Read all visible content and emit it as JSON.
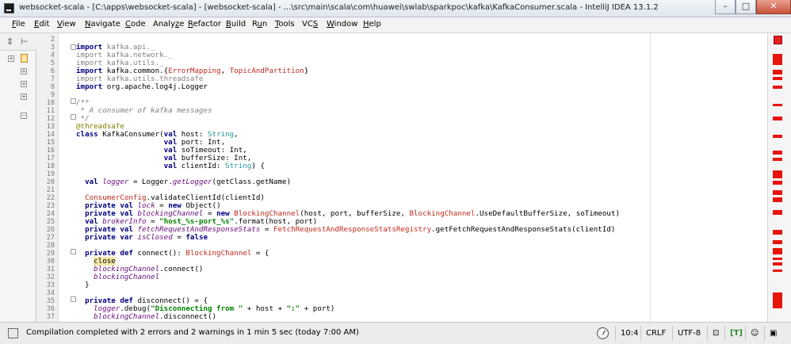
{
  "window": {
    "title": "websocket-scala - [C:\\apps\\websocket-scala] - [websocket-scala] - ...\\src\\main\\scala\\com\\huawei\\swlab\\sparkpoc\\kafka\\KafkaConsumer.scala - IntelliJ IDEA 13.1.2",
    "buttons": {
      "minimize": "–",
      "maximize": "□",
      "close": "✕"
    }
  },
  "menu": [
    {
      "pre": "",
      "ul": "F",
      "post": "ile"
    },
    {
      "pre": "",
      "ul": "E",
      "post": "dit"
    },
    {
      "pre": "",
      "ul": "V",
      "post": "iew"
    },
    {
      "pre": "",
      "ul": "N",
      "post": "avigate"
    },
    {
      "pre": "",
      "ul": "C",
      "post": "ode"
    },
    {
      "pre": "Analy",
      "ul": "z",
      "post": "e"
    },
    {
      "pre": "",
      "ul": "R",
      "post": "efactor"
    },
    {
      "pre": "",
      "ul": "B",
      "post": "uild"
    },
    {
      "pre": "R",
      "ul": "u",
      "post": "n"
    },
    {
      "pre": "",
      "ul": "T",
      "post": "ools"
    },
    {
      "pre": "VC",
      "ul": "S",
      "post": ""
    },
    {
      "pre": "",
      "ul": "W",
      "post": "indow"
    },
    {
      "pre": "",
      "ul": "H",
      "post": "elp"
    }
  ],
  "toolbar": {
    "collapse_icon": "collapse-all-icon",
    "settings_icon": "settings-icon"
  },
  "editor": {
    "line_numbers": [
      "2",
      "3",
      "4",
      "5",
      "6",
      "7",
      "8",
      "9",
      "10",
      "11",
      "12",
      "13",
      "14",
      "15",
      "16",
      "17",
      "18",
      "19",
      "20",
      "21",
      "22",
      "23",
      "24",
      "25",
      "26",
      "27",
      "28",
      "29",
      "30",
      "31",
      "32",
      "33",
      "34",
      "35",
      "36",
      "37"
    ],
    "lines": [
      [],
      [
        [
          "k",
          "import "
        ],
        [
          "p",
          "kafka.api._"
        ]
      ],
      [
        [
          "p",
          "import kafka.network._"
        ]
      ],
      [
        [
          "p",
          "import kafka.utils._"
        ]
      ],
      [
        [
          "k",
          "import "
        ],
        [
          "",
          "kafka.common.{"
        ],
        [
          "r",
          "ErrorMapping"
        ],
        [
          "",
          ", "
        ],
        [
          "r",
          "TopicAndPartition"
        ],
        [
          "",
          "}"
        ]
      ],
      [
        [
          "p",
          "import kafka.utils.threadsafe"
        ]
      ],
      [
        [
          "k",
          "import "
        ],
        [
          "",
          "org.apache.log4j.Logger"
        ]
      ],
      [],
      [
        [
          "c",
          "/**"
        ]
      ],
      [
        [
          "c",
          " * A consumer of kafka messages"
        ]
      ],
      [
        [
          "c",
          " */"
        ]
      ],
      [
        [
          "a",
          "@threadsafe"
        ]
      ],
      [
        [
          "k",
          "class "
        ],
        [
          "",
          "KafkaConsumer("
        ],
        [
          "k",
          "val "
        ],
        [
          "",
          "host: "
        ],
        [
          "t",
          "String"
        ],
        [
          "",
          ","
        ]
      ],
      [
        [
          "",
          "                    "
        ],
        [
          "k",
          "val "
        ],
        [
          "",
          "port: Int,"
        ]
      ],
      [
        [
          "",
          "                    "
        ],
        [
          "k",
          "val "
        ],
        [
          "",
          "soTimeout: Int,"
        ]
      ],
      [
        [
          "",
          "                    "
        ],
        [
          "k",
          "val "
        ],
        [
          "",
          "bufferSize: Int,"
        ]
      ],
      [
        [
          "",
          "                    "
        ],
        [
          "k",
          "val "
        ],
        [
          "",
          "clientId: "
        ],
        [
          "t",
          "String"
        ],
        [
          "",
          ") {"
        ]
      ],
      [],
      [
        [
          "",
          "  "
        ],
        [
          "k",
          "val "
        ],
        [
          "i",
          "logger"
        ],
        [
          "",
          " = Logger."
        ],
        [
          "i",
          "getLogger"
        ],
        [
          "",
          "(getClass.getName)"
        ]
      ],
      [],
      [
        [
          "",
          "  "
        ],
        [
          "r",
          "ConsumerConfig"
        ],
        [
          "",
          ".validateClientId(clientId)"
        ]
      ],
      [
        [
          "",
          "  "
        ],
        [
          "k",
          "private val "
        ],
        [
          "i",
          "lock"
        ],
        [
          "",
          " = "
        ],
        [
          "k",
          "new "
        ],
        [
          "",
          "Object()"
        ]
      ],
      [
        [
          "",
          "  "
        ],
        [
          "k",
          "private val "
        ],
        [
          "i",
          "blockingChannel"
        ],
        [
          "",
          " = "
        ],
        [
          "k",
          "new "
        ],
        [
          "r",
          "BlockingChannel"
        ],
        [
          "",
          "(host, port, bufferSize, "
        ],
        [
          "r",
          "BlockingChannel"
        ],
        [
          "",
          ".UseDefaultBufferSize, soTimeout)"
        ]
      ],
      [
        [
          "",
          "  "
        ],
        [
          "k",
          "val "
        ],
        [
          "i",
          "brokerInfo"
        ],
        [
          "",
          " = "
        ],
        [
          "s",
          "\"host_%s-port_%s\""
        ],
        [
          "",
          ".format(host, port)"
        ]
      ],
      [
        [
          "",
          "  "
        ],
        [
          "k",
          "private val "
        ],
        [
          "i",
          "fetchRequestAndResponseStats"
        ],
        [
          "",
          " = "
        ],
        [
          "r",
          "FetchRequestAndResponseStatsRegistry"
        ],
        [
          "",
          ".getFetchRequestAndResponseStats(clientId)"
        ]
      ],
      [
        [
          "",
          "  "
        ],
        [
          "k",
          "private var "
        ],
        [
          "i",
          "isClosed"
        ],
        [
          "",
          " = "
        ],
        [
          "k",
          "false"
        ]
      ],
      [],
      [
        [
          "",
          "  "
        ],
        [
          "k",
          "private def "
        ],
        [
          "",
          "connect(): "
        ],
        [
          "r",
          "BlockingChannel"
        ],
        [
          "",
          " = {"
        ]
      ],
      [
        [
          "",
          "    "
        ],
        [
          "hl",
          "close"
        ]
      ],
      [
        [
          "",
          "    "
        ],
        [
          "i",
          "blockingChannel"
        ],
        [
          "",
          ".connect()"
        ]
      ],
      [
        [
          "",
          "    "
        ],
        [
          "i",
          "blockingChannel"
        ]
      ],
      [
        [
          "",
          "  }"
        ]
      ],
      [],
      [
        [
          "",
          "  "
        ],
        [
          "k",
          "private def "
        ],
        [
          "",
          "disconnect() = {"
        ]
      ],
      [
        [
          "",
          "    "
        ],
        [
          "i",
          "logger"
        ],
        [
          "",
          ".debug("
        ],
        [
          "s",
          "\"Disconnecting from \""
        ],
        [
          "",
          " + host + "
        ],
        [
          "s",
          "\":\""
        ],
        [
          "",
          " + port)"
        ]
      ],
      [
        [
          "",
          "    "
        ],
        [
          "i",
          "blockingChannel"
        ],
        [
          "",
          ".disconnect()"
        ]
      ]
    ]
  },
  "status": {
    "message": "Compilation completed with 2 errors and 2 warnings in 1 min 5 sec (today 7:00 AM)",
    "position": "10:4",
    "line_separator": "CRLF",
    "encoding": "UTF-8",
    "inspection_label": "[T]",
    "colors": {
      "error": "#e8140c",
      "warning": "#d8c020",
      "keyword": "#000080",
      "string": "#008000"
    }
  }
}
